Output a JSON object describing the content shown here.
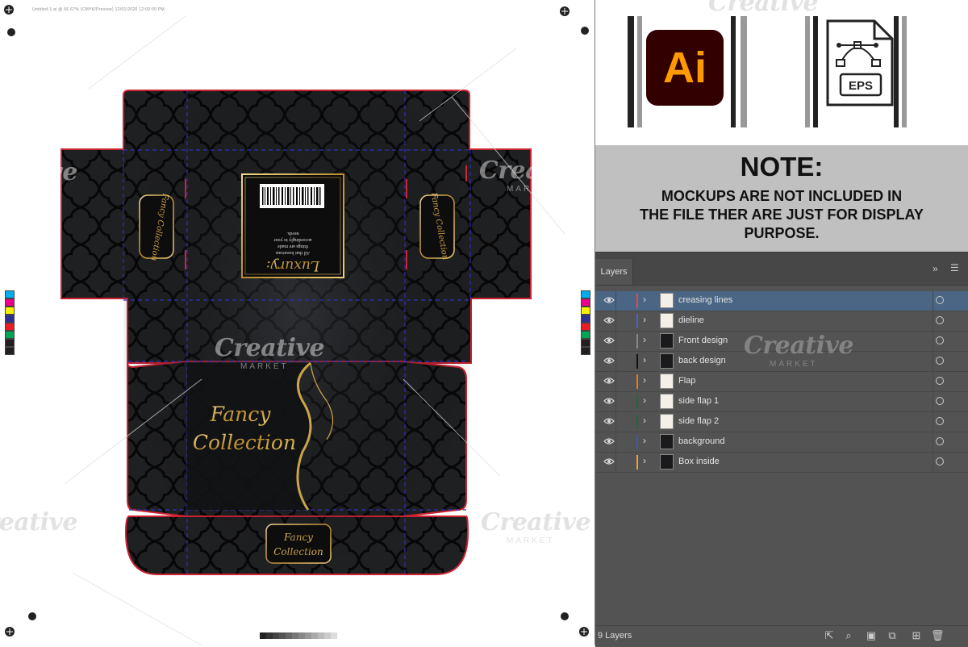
{
  "artboard": {
    "header_text": "Untitled-1.ai @ 66.67% (CMYK/Preview)      12/01/2020   12:00:00 PM",
    "box": {
      "inside_label": "Luxury:",
      "inside_text_lines": [
        "All that luxurious",
        "things are made",
        "accordingly to your",
        "needs."
      ],
      "front_line1": "Fancy",
      "front_line2": "Collection",
      "flap_line1": "Fancy",
      "flap_line2": "Collection",
      "side_label_1": "Fancy Collection",
      "side_label_2": "Fancy Collection"
    },
    "swatch_colors": [
      "#00aeef",
      "#ec008c",
      "#fff200",
      "#2e3192",
      "#ed1c24",
      "#00a651",
      "#231f20",
      "#231f20"
    ],
    "colors": {
      "box_fill": "#1f2022",
      "pattern_stroke": "#0a0a0a",
      "dieline": "#cc2233",
      "crease": "#3030b8",
      "gold": "#c9a44a"
    }
  },
  "watermark": {
    "brand": "Creative",
    "sub": "MARKET"
  },
  "icons": {
    "ai_icon_label": "Ai",
    "eps_icon_label": "EPS",
    "ai_icon": "adobe-illustrator-icon",
    "eps_icon": "eps-file-icon"
  },
  "note": {
    "title": "NOTE:",
    "line1": "MOCKUPS ARE NOT INCLUDED IN",
    "line2": "THE FILE THER ARE JUST FOR DISPLAY",
    "line3": "PURPOSE."
  },
  "layers_panel": {
    "tab_label": "Layers",
    "collapse_icon": "double-chevron-icon",
    "menu_icon": "hamburger-menu-icon",
    "layers": [
      {
        "name": "creasing lines",
        "color": "#ee4444",
        "selected": true
      },
      {
        "name": "dieline",
        "color": "#4466cc",
        "selected": false
      },
      {
        "name": "Front design",
        "color": "#888888",
        "selected": false
      },
      {
        "name": "back design",
        "color": "#111111",
        "selected": false
      },
      {
        "name": "Flap",
        "color": "#e07a2a",
        "selected": false
      },
      {
        "name": "side flap 1",
        "color": "#1a6a3a",
        "selected": false
      },
      {
        "name": "side flap 2",
        "color": "#1a6a3a",
        "selected": false
      },
      {
        "name": "background",
        "color": "#3a5ab0",
        "selected": false
      },
      {
        "name": "Box inside",
        "color": "#e8a040",
        "selected": false
      }
    ],
    "footer_count": "9 Layers",
    "footer_icons": [
      "export-icon",
      "search-icon",
      "clipping-mask-icon",
      "sublayer-icon",
      "new-layer-icon",
      "delete-icon"
    ]
  }
}
